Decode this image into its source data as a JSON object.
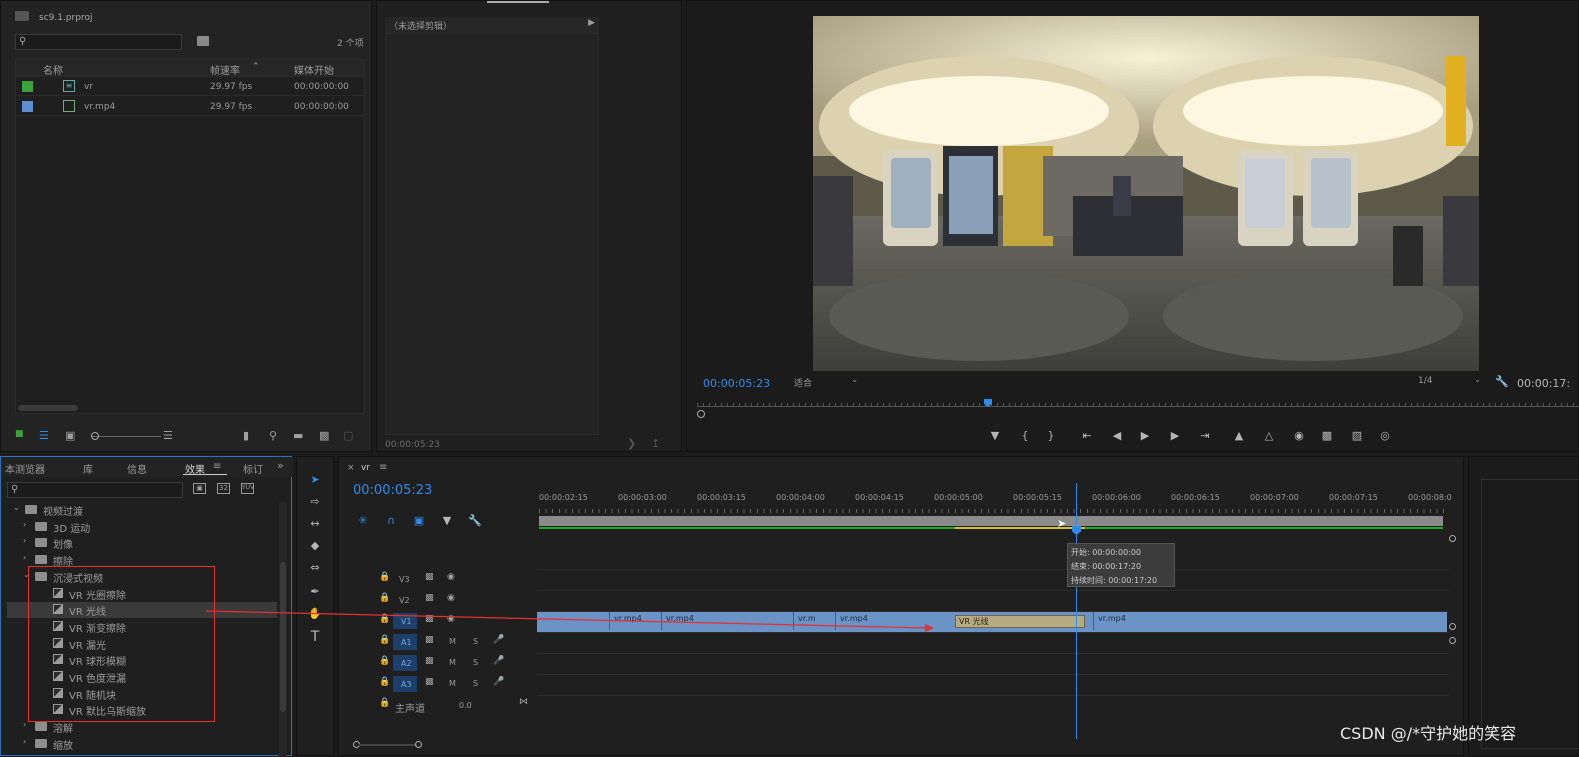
{
  "project": {
    "file_name": "sc9.1.prproj",
    "item_count": "2 个项",
    "columns": [
      "名称",
      "帧速率",
      "媒体开始"
    ],
    "items": [
      {
        "name": "vr",
        "fps": "29.97 fps",
        "start": "00:00:00:00",
        "color": "#3aa23a"
      },
      {
        "name": "vr.mp4",
        "fps": "29.97 fps",
        "start": "00:00:00:00",
        "color": "#5b8fd0"
      }
    ]
  },
  "source": {
    "header": "（未选择剪辑）",
    "timecode": "00:00:05:23"
  },
  "program": {
    "timecode": "00:00:05:23",
    "fit": "适合",
    "resolution": "1/4",
    "duration": "00:00:17:",
    "accent": "#2d8ceb"
  },
  "effects_panel": {
    "tabs": [
      "本测览器",
      "库",
      "信息",
      "效果",
      "标订"
    ],
    "active_tab": "效果",
    "tree": [
      {
        "label": "视频过渡",
        "depth": 0,
        "kind": "folder",
        "open": true
      },
      {
        "label": "3D 运动",
        "depth": 1,
        "kind": "folder"
      },
      {
        "label": "划像",
        "depth": 1,
        "kind": "folder"
      },
      {
        "label": "擦除",
        "depth": 1,
        "kind": "folder"
      },
      {
        "label": "沉浸式视频",
        "depth": 1,
        "kind": "folder",
        "open": true
      },
      {
        "label": "VR 光圈擦除",
        "depth": 2,
        "kind": "effect"
      },
      {
        "label": "VR 光线",
        "depth": 2,
        "kind": "effect",
        "selected": true
      },
      {
        "label": "VR 渐变擦除",
        "depth": 2,
        "kind": "effect"
      },
      {
        "label": "VR 漏光",
        "depth": 2,
        "kind": "effect"
      },
      {
        "label": "VR 球形模糊",
        "depth": 2,
        "kind": "effect"
      },
      {
        "label": "VR 色度泄漏",
        "depth": 2,
        "kind": "effect"
      },
      {
        "label": "VR 随机块",
        "depth": 2,
        "kind": "effect"
      },
      {
        "label": "VR 默比乌斯缩放",
        "depth": 2,
        "kind": "effect"
      },
      {
        "label": "溶解",
        "depth": 1,
        "kind": "folder"
      },
      {
        "label": "缩放",
        "depth": 1,
        "kind": "folder"
      }
    ]
  },
  "timeline": {
    "sequence_name": "vr",
    "timecode": "00:00:05:23",
    "ruler": [
      "00:00:02:15",
      "00:00:03:00",
      "00:00:03:15",
      "00:00:04:00",
      "00:00:04:15",
      "00:00:05:00",
      "00:00:05:15",
      "00:00:06:00",
      "00:00:06:15",
      "00:00:07:00",
      "00:00:07:15",
      "00:00:08:0"
    ],
    "video_tracks": [
      "V3",
      "V2",
      "V1"
    ],
    "audio_tracks": [
      "A1",
      "A2",
      "A3"
    ],
    "master_label": "主声道",
    "master_value": "0.0",
    "track_buttons": {
      "mute": "M",
      "solo": "S"
    },
    "clips": [
      "vr.mp4",
      "vr.mp4",
      "vr.m",
      "vr.mp4",
      "VR 光线",
      "vr.mp4"
    ],
    "tooltip": {
      "start": "开始: 00:00:00:00",
      "end": "结束: 00:00:17:20",
      "duration": "持续时间: 00:00:17:20"
    }
  },
  "watermark": "CSDN @/*守护她的笑容"
}
